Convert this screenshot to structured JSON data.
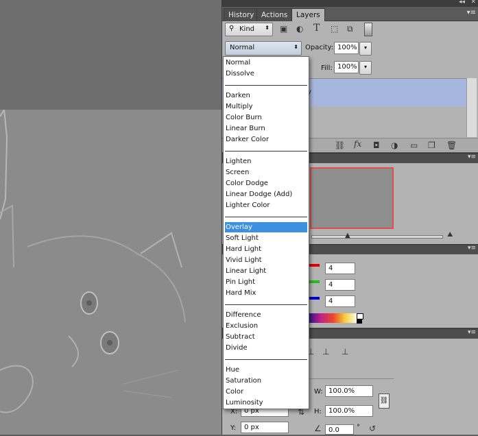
{
  "panel": {
    "tabs": [
      {
        "label": "History"
      },
      {
        "label": "Actions"
      },
      {
        "label": "Layers"
      }
    ],
    "filter_kind": "Kind",
    "blend_mode_value": "Normal",
    "opacity_label": "Opacity:",
    "opacity_value": "100%",
    "fill_label": "Fill:",
    "fill_value": "100%",
    "layer_partial_text": "y"
  },
  "info": {
    "red_value": "4",
    "green_value": "4",
    "blue_value": "4"
  },
  "transform": {
    "w_label": "W:",
    "w_value": "100.0%",
    "h_label": "H:",
    "h_value": "100.0%",
    "x_label": "X:",
    "x_value": "0 px",
    "y_label": "Y:",
    "y_value": "0 px",
    "angle_value": "0.0",
    "angle_unit": "°"
  },
  "blend_menu": {
    "groups": [
      [
        "Normal",
        "Dissolve"
      ],
      [
        "Darken",
        "Multiply",
        "Color Burn",
        "Linear Burn",
        "Darker Color"
      ],
      [
        "Lighten",
        "Screen",
        "Color Dodge",
        "Linear Dodge (Add)",
        "Lighter Color"
      ],
      [
        "Overlay",
        "Soft Light",
        "Hard Light",
        "Vivid Light",
        "Linear Light",
        "Pin Light",
        "Hard Mix"
      ],
      [
        "Difference",
        "Exclusion",
        "Subtract",
        "Divide"
      ],
      [
        "Hue",
        "Saturation",
        "Color",
        "Luminosity"
      ]
    ],
    "selected": "Overlay"
  },
  "colors": {
    "menu_highlight": "#3d8fe0",
    "selected_layer": "#a7b6dd",
    "red_slider": "#e00000",
    "green_slider": "#22bb22",
    "blue_slider": "#0000d0",
    "nav_box": "#e05050"
  }
}
